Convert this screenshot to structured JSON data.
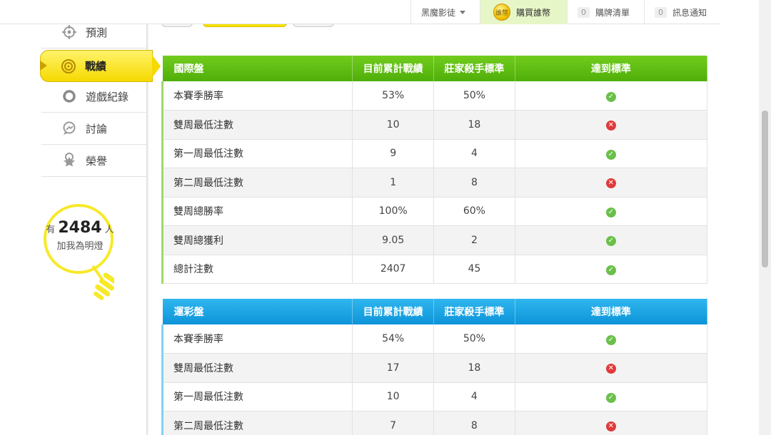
{
  "topbar": {
    "user": "黑魔影徒",
    "buy": "購買誰幣",
    "coin_label": "誰幣",
    "cart_count": "0",
    "cart": "購牌清單",
    "notice_count": "0",
    "notice": "訊息通知"
  },
  "sidebar": {
    "items": [
      {
        "label": "預測",
        "icon": "target-icon"
      },
      {
        "label": "戰績",
        "icon": "medal-icon"
      },
      {
        "label": "遊戲紀錄",
        "icon": "ring-icon"
      },
      {
        "label": "討論",
        "icon": "chat-icon"
      },
      {
        "label": "榮譽",
        "icon": "award-icon"
      }
    ],
    "bulb": {
      "prefix": "有",
      "count": "2484",
      "suffix": "人",
      "caption": "加我為明燈"
    }
  },
  "tables": [
    {
      "title": "國際盤",
      "headers": [
        "目前累計戰績",
        "莊家殺手標準",
        "達到標準"
      ],
      "rows": [
        {
          "label": "本賽季勝率",
          "current": "53%",
          "standard": "50%",
          "met": true
        },
        {
          "label": "雙周最低注數",
          "current": "10",
          "standard": "18",
          "met": false
        },
        {
          "label": "第一周最低注數",
          "current": "9",
          "standard": "4",
          "met": true
        },
        {
          "label": "第二周最低注數",
          "current": "1",
          "standard": "8",
          "met": false
        },
        {
          "label": "雙周總勝率",
          "current": "100%",
          "standard": "60%",
          "met": true
        },
        {
          "label": "雙周總獲利",
          "current": "9.05",
          "standard": "2",
          "met": true
        },
        {
          "label": "總計注數",
          "current": "2407",
          "standard": "45",
          "met": true
        }
      ]
    },
    {
      "title": "運彩盤",
      "headers": [
        "目前累計戰績",
        "莊家殺手標準",
        "達到標準"
      ],
      "rows": [
        {
          "label": "本賽季勝率",
          "current": "54%",
          "standard": "50%",
          "met": true
        },
        {
          "label": "雙周最低注數",
          "current": "17",
          "standard": "18",
          "met": false
        },
        {
          "label": "第一周最低注數",
          "current": "10",
          "standard": "4",
          "met": true
        },
        {
          "label": "第二周最低注數",
          "current": "7",
          "standard": "8",
          "met": false
        }
      ]
    }
  ],
  "colors": {
    "green_header": "#5cba11",
    "blue_header": "#1ba5e4",
    "accent_yellow": "#f6d900",
    "ok": "#6bbf4a",
    "fail": "#e03a3a"
  }
}
